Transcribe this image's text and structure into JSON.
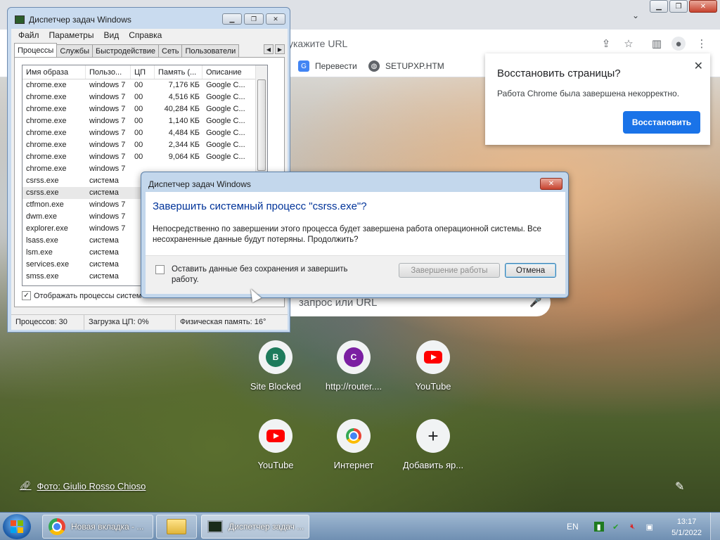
{
  "chrome": {
    "omnibox_placeholder": "укажите URL",
    "bookmarks": [
      {
        "label": "Перевести",
        "icon": "google-translate-icon",
        "color": "#4285f4"
      },
      {
        "label": "SETUPXP.HTM",
        "icon": "globe-icon",
        "color": "#5f6368"
      }
    ],
    "search_placeholder": "запрос или URL",
    "tiles": [
      {
        "label": "Site Blocked",
        "letter": "B",
        "color": "#1e7b5c"
      },
      {
        "label": "http://router....",
        "letter": "C",
        "color": "#7b1fa2"
      },
      {
        "label": "YouTube",
        "icon": "youtube-icon"
      },
      {
        "label": "YouTube",
        "icon": "youtube-icon"
      },
      {
        "label": "Интернет",
        "icon": "chrome-icon"
      },
      {
        "label": "Добавить яр...",
        "icon": "plus-icon"
      }
    ],
    "photo_credit": "Фото: Giulio Rosso Chioso"
  },
  "restore_popup": {
    "title": "Восстановить страницы?",
    "text": "Работа Chrome была завершена некорректно.",
    "button": "Восстановить",
    "accent": "#1a73e8"
  },
  "task_manager": {
    "title": "Диспетчер задач Windows",
    "menu": [
      "Файл",
      "Параметры",
      "Вид",
      "Справка"
    ],
    "tabs": [
      "Процессы",
      "Службы",
      "Быстродействие",
      "Сеть",
      "Пользователи"
    ],
    "active_tab": "Процессы",
    "columns": [
      "Имя образа",
      "Пользо...",
      "ЦП",
      "Память (...",
      "Описание"
    ],
    "rows": [
      [
        "chrome.exe",
        "windows 7",
        "00",
        "7,176 КБ",
        "Google C..."
      ],
      [
        "chrome.exe",
        "windows 7",
        "00",
        "4,516 КБ",
        "Google C..."
      ],
      [
        "chrome.exe",
        "windows 7",
        "00",
        "40,284 КБ",
        "Google C..."
      ],
      [
        "chrome.exe",
        "windows 7",
        "00",
        "1,140 КБ",
        "Google C..."
      ],
      [
        "chrome.exe",
        "windows 7",
        "00",
        "4,484 КБ",
        "Google C..."
      ],
      [
        "chrome.exe",
        "windows 7",
        "00",
        "2,344 КБ",
        "Google C..."
      ],
      [
        "chrome.exe",
        "windows 7",
        "00",
        "9,064 КБ",
        "Google C..."
      ],
      [
        "chrome.exe",
        "windows 7",
        "",
        "",
        ""
      ],
      [
        "csrss.exe",
        "система",
        "",
        "",
        ""
      ],
      [
        "csrss.exe",
        "система",
        "",
        "",
        ""
      ],
      [
        "ctfmon.exe",
        "windows 7",
        "",
        "",
        ""
      ],
      [
        "dwm.exe",
        "windows 7",
        "",
        "",
        ""
      ],
      [
        "explorer.exe",
        "windows 7",
        "",
        "",
        ""
      ],
      [
        "lsass.exe",
        "система",
        "",
        "",
        ""
      ],
      [
        "lsm.exe",
        "система",
        "",
        "",
        ""
      ],
      [
        "services.exe",
        "система",
        "",
        "",
        ""
      ],
      [
        "smss.exe",
        "система",
        "",
        "",
        ""
      ]
    ],
    "selected_row": 9,
    "show_all_label": "Отображать процессы систем",
    "status": {
      "processes": "Процессов: 30",
      "cpu": "Загрузка ЦП: 0%",
      "memory": "Физическая память: 16°"
    }
  },
  "dialog": {
    "title": "Диспетчер задач Windows",
    "heading": "Завершить системный процесс \"csrss.exe\"?",
    "text": "Непосредственно по завершении этого процесса будет завершена работа операционной системы. Все несохраненные данные будут потеряны.  Продолжить?",
    "checkbox_label": "Оставить данные без сохранения и завершить работу.",
    "shutdown_button": "Завершение работы",
    "cancel_button": "Отмена"
  },
  "taskbar": {
    "items": [
      {
        "label": "Новая вкладка - ...",
        "icon": "chrome-icon"
      },
      {
        "label": "",
        "icon": "folder-icon"
      },
      {
        "label": "Диспетчер задач ...",
        "icon": "task-manager-icon"
      }
    ],
    "language": "EN",
    "time": "13:17",
    "date": "5/1/2022"
  }
}
